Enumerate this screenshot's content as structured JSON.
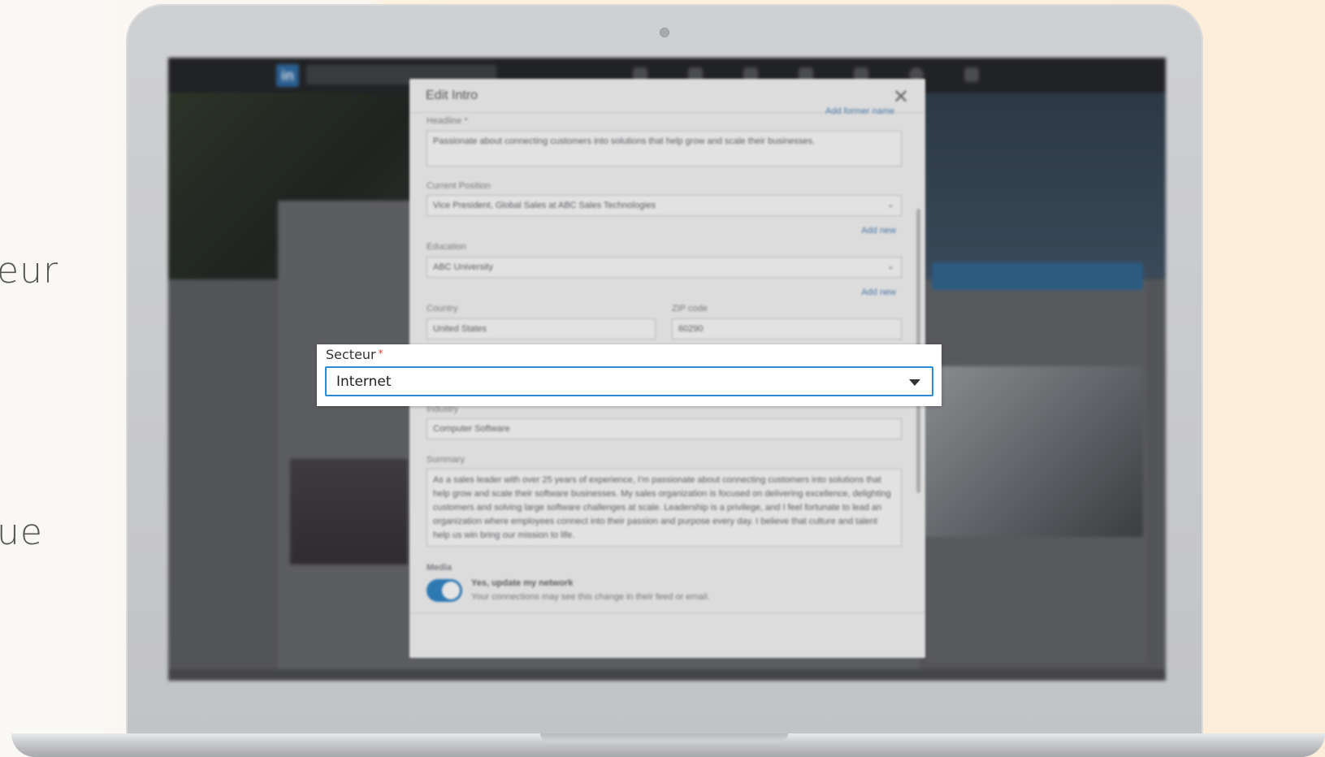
{
  "background": {
    "side_text_top": "eur",
    "side_text_bottom": "ue"
  },
  "modal": {
    "title": "Edit Intro",
    "close_glyph": "✕",
    "top_link": "Add former name",
    "headline_label": "Headline *",
    "headline_value": "Passionate about connecting customers into solutions that help grow and scale their businesses.",
    "position_label": "Current Position",
    "position_value": "Vice President, Global Sales at ABC Sales Technologies",
    "add_new_position": "Add new",
    "education_label": "Education",
    "education_value": "ABC University",
    "add_new_education": "Add new",
    "country_label": "Country",
    "country_value": "United States",
    "zip_label": "ZIP code",
    "zip_value": "60290",
    "industry_label": "Industry",
    "industry_value": "Computer Software",
    "summary_label": "Summary",
    "summary_value": "As a sales leader with over 25 years of experience, I'm passionate about connecting customers into solutions that help grow and scale their software businesses. My sales organization is focused on delivering excellence, delighting customers and solving large software challenges at scale. Leadership is a privilege, and I feel fortunate to lead an organization where employees connect into their passion and purpose every day. I believe that culture and talent help us win bring our mission to life.",
    "media_label": "Media",
    "toggle_title": "Yes, update my network",
    "toggle_subtitle": "Your connections may see this change in their feed or email.",
    "toggle_on": true
  },
  "highlight": {
    "label": "Secteur",
    "required_mark": "*",
    "value": "Internet"
  },
  "colors": {
    "accent": "#2e8ad6",
    "toggle": "#2f79b3",
    "required": "#d1462f"
  }
}
